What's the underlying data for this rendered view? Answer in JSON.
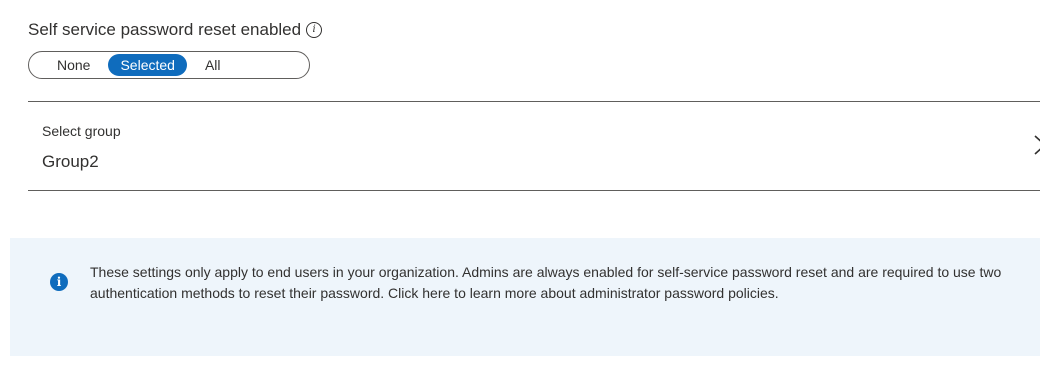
{
  "sspr": {
    "title": "Self service password reset enabled",
    "info_icon": "info-icon",
    "options": [
      "None",
      "Selected",
      "All"
    ],
    "selected_option": "Selected"
  },
  "group": {
    "label": "Select group",
    "value": "Group2",
    "chevron_icon": "chevron-right-icon"
  },
  "notice": {
    "icon": "info-filled-icon",
    "text": "These settings only apply to end users in your organization. Admins are always enabled for self-service password reset and are required to use two authentication methods to reset their password. Click here to learn more about administrator password policies."
  },
  "colors": {
    "accent": "#0f6cbd",
    "notice_background": "#eef5fb"
  }
}
